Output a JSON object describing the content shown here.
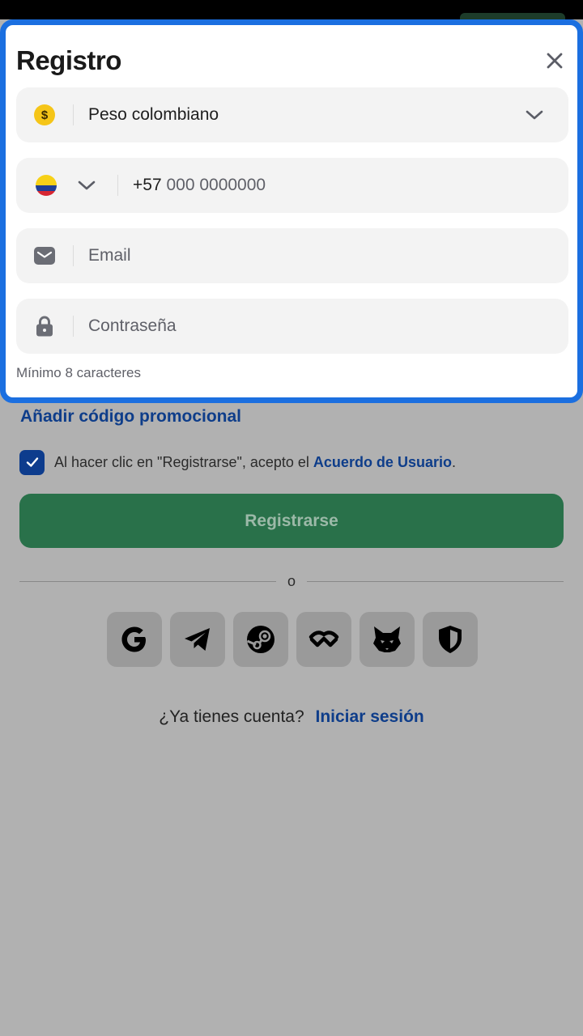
{
  "modal": {
    "title": "Registro",
    "currency": {
      "value": "Peso colombiano",
      "icon": "dollar-coin-icon"
    },
    "phone": {
      "code": "+57",
      "placeholder": "000 0000000",
      "country_flag": "colombia-flag-icon"
    },
    "email": {
      "placeholder": "Email"
    },
    "password": {
      "placeholder": "Contraseña",
      "hint": "Mínimo 8 caracteres"
    }
  },
  "page": {
    "promo_link": "Añadir código promocional",
    "consent": {
      "checked": true,
      "text": "Al hacer clic en \"Registrarse\", acepto el ",
      "link": "Acuerdo de Usuario",
      "suffix": "."
    },
    "register_button": "Registrarse",
    "divider_text": "o",
    "socials": [
      "google-icon",
      "telegram-icon",
      "steam-icon",
      "walletconnect-icon",
      "metamask-icon",
      "shield-icon"
    ],
    "login_prompt": "¿Ya tienes cuenta?",
    "login_link": "Iniciar sesión"
  },
  "colors": {
    "accent": "#1b6fe0",
    "link": "#0e3d8a",
    "primary_button": "#29714a",
    "overlay": "#b1b1b1"
  }
}
